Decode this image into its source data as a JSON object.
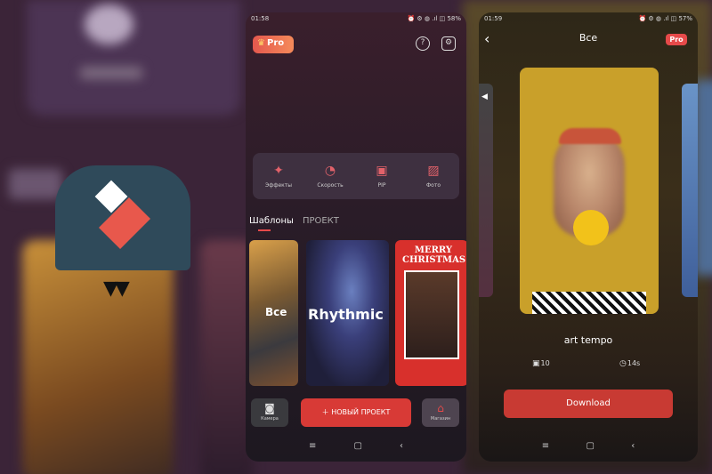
{
  "logo": {
    "brand_mark": "W"
  },
  "phone1": {
    "status": {
      "time": "01:58",
      "icons": "⏰ ⚙ ◍ .ıl ◫ 58%"
    },
    "pro_badge": "Pro",
    "tools": [
      {
        "label": "Эффекты",
        "icon": "effects-icon"
      },
      {
        "label": "Скорость",
        "icon": "speedometer-icon"
      },
      {
        "label": "PIP",
        "icon": "pip-icon"
      },
      {
        "label": "Фото",
        "icon": "photo-icon"
      }
    ],
    "tabs": {
      "templates": "Шаблоны",
      "project": "ПРОЕКТ"
    },
    "templates": {
      "all": "Все",
      "rhythmic": "Rhythmic",
      "xmas": "MERRY CHRISTMAS"
    },
    "bottom": {
      "camera": "Камера",
      "new_project": "НОВЫЙ ПРОЕКТ",
      "shop": "Магазин"
    }
  },
  "phone2": {
    "status": {
      "time": "01:59",
      "icons": "⏰ ⚙ ◍ .ıl ◫ 57%"
    },
    "title": "Все",
    "pro_badge": "Pro",
    "template_name": "art tempo",
    "clips": "10",
    "duration": "14s",
    "download": "Download"
  },
  "colors": {
    "accent": "#d83a36",
    "pro_gradient_start": "#e4584e",
    "pro_gradient_end": "#f58a5a"
  }
}
